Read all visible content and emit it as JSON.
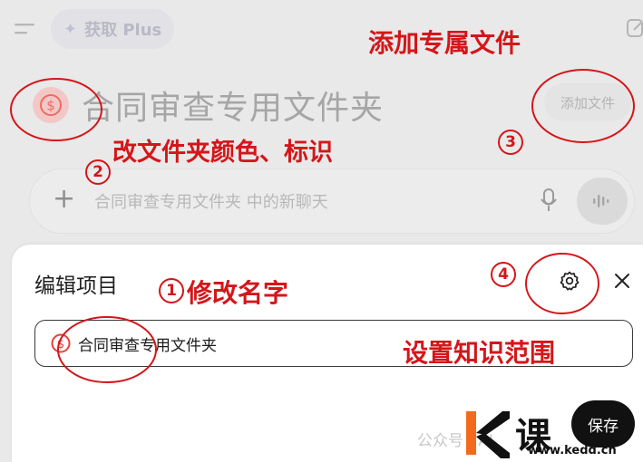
{
  "topbar": {
    "plus_label": "获取 Plus",
    "menu_icon": "menu-icon",
    "sparkle_icon": "sparkle-icon",
    "edit_icon": "new-chat-icon"
  },
  "folder": {
    "title": "合同审查专用文件夹",
    "add_file_label": "添加文件",
    "badge_icon": "dollar-badge-icon",
    "badge_color": "#e26a62"
  },
  "composer": {
    "placeholder": "合同审查专用文件夹 中的新聊天",
    "plus_icon": "plus-icon",
    "mic_icon": "mic-icon",
    "voice_icon": "voice-mode-icon"
  },
  "dialog": {
    "title": "编辑项目",
    "name_value": "合同审查专用文件夹",
    "settings_icon": "gear-icon",
    "close_icon": "close-icon",
    "save_label": "保存"
  },
  "annotations": {
    "add_file": "添加专属文件",
    "change_color": "改文件夹颜色、标识",
    "rename": "修改名字",
    "knowledge": "设置知识范围",
    "n1": "1",
    "n2": "2",
    "n3": "3",
    "n4": "4",
    "color": "#d4161a"
  },
  "watermark": {
    "text": "公众号 · AI",
    "brand": "课",
    "url": "www.kedd.cn"
  }
}
